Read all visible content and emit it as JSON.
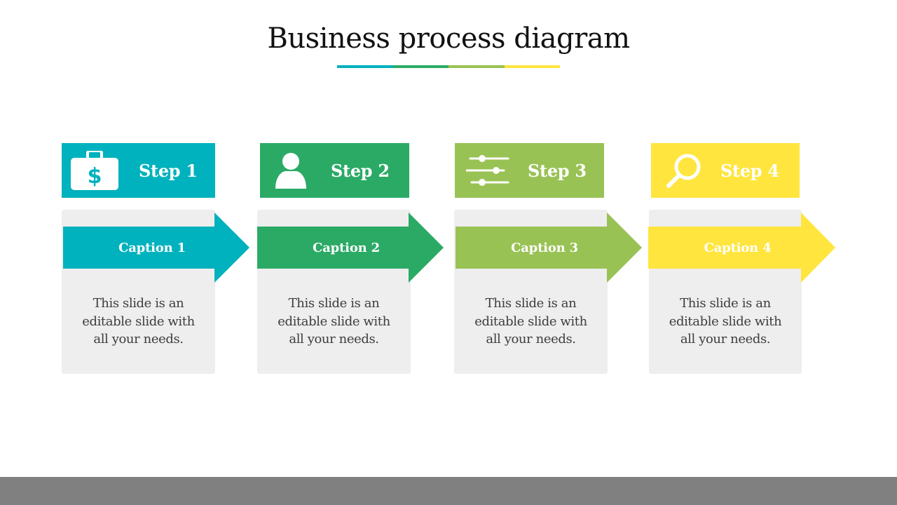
{
  "title": "Business process diagram",
  "underline_colors": [
    "#00B2BD",
    "#2BAA66",
    "#99C254",
    "#FFE53E"
  ],
  "steps": [
    {
      "label": "Step 1",
      "icon": "briefcase-dollar-icon",
      "caption": "Caption 1",
      "text_lines": [
        "This slide is an",
        "editable slide with",
        "all your needs."
      ],
      "color": "#00B2BD"
    },
    {
      "label": "Step 2",
      "icon": "user-icon",
      "caption": "Caption 2",
      "text_lines": [
        "This slide is an",
        "editable slide with",
        "all your needs."
      ],
      "color": "#2BAA66"
    },
    {
      "label": "Step 3",
      "icon": "sliders-icon",
      "caption": "Caption 3",
      "text_lines": [
        "This slide is an",
        "editable slide with",
        "all your needs."
      ],
      "color": "#99C254"
    },
    {
      "label": "Step 4",
      "icon": "search-icon",
      "caption": "Caption 4",
      "text_lines": [
        "This slide is an",
        "editable slide with",
        "all your needs."
      ],
      "color": "#FFE53E"
    }
  ],
  "footer_bar_color": "#808080"
}
